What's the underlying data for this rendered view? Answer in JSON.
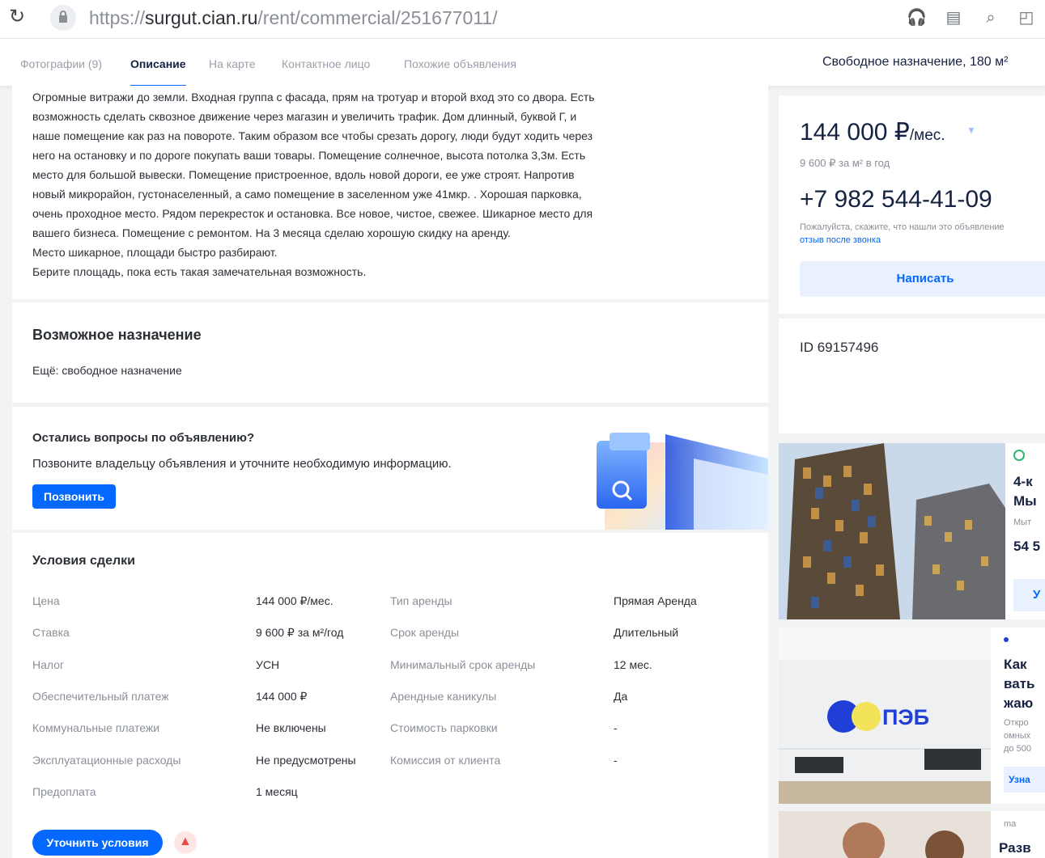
{
  "browser": {
    "url_scheme": "https://",
    "url_host": "surgut.cian.ru",
    "url_path": "/rent/commercial/251677011/"
  },
  "tabs": {
    "photos": "Фотографии (9)",
    "description": "Описание",
    "map": "На карте",
    "contact": "Контактное лицо",
    "similar": "Похожие объявления",
    "listing_title": "Свободное назначение, 180 м²"
  },
  "description": {
    "lines": [
      "Огромные витражи до земли. Входная группа с фасада, прям на тротуар и второй вход это со двора. Есть",
      "возможность сделать сквозное движение через магазин и увеличить трафик. Дом длинный, буквой Г, и",
      "наше помещение как раз на повороте. Таким образом все чтобы срезать дорогу, люди будут ходить через",
      "него на остановку и по дороге покупать ваши товары. Помещение солнечное, высота потолка 3,3м. Есть",
      "место для большой вывески. Помещение пристроенное, вдоль новой дороги, ее уже строят. Напротив",
      "новый микрорайон, густонаселенный, а само помещение в заселенном уже 41мкр. . Хорошая парковка,",
      "очень проходное место. Рядом перекресток и остановка. Все новое, чистое, свежее. Шикарное место для",
      "вашего бизнеса. Помещение с ремонтом. На 3 месяца сделаю хорошую скидку на аренду.",
      " Место шикарное, площади быстро разбирают.",
      "Берите площадь, пока есть такая замечательная возможность."
    ]
  },
  "purpose": {
    "title": "Возможное назначение",
    "text": "Ещё: свободное назначение"
  },
  "questions": {
    "title": "Остались вопросы по объявлению?",
    "text": "Позвоните владельцу объявления и уточните необходимую информацию.",
    "call_button": "Позвонить"
  },
  "terms": {
    "title": "Условия сделки",
    "left": [
      {
        "label": "Цена",
        "value": "144 000 ₽/мес."
      },
      {
        "label": "Ставка",
        "value": "9 600 ₽ за м²/год"
      },
      {
        "label": "Налог",
        "value": "УСН"
      },
      {
        "label": "Обеспечительный платеж",
        "value": "144 000 ₽"
      },
      {
        "label": "Коммунальные платежи",
        "value": "Не включены"
      },
      {
        "label": "Эксплуатационные расходы",
        "value": "Не предусмотрены"
      },
      {
        "label": "Предоплата",
        "value": "1 месяц"
      }
    ],
    "right": [
      {
        "label": "Тип аренды",
        "value": "Прямая Аренда"
      },
      {
        "label": "Срок аренды",
        "value": "Длительный"
      },
      {
        "label": "Минимальный срок аренды",
        "value": "12 мес."
      },
      {
        "label": "Арендные каникулы",
        "value": "Да"
      },
      {
        "label": "Стоимость парковки",
        "value": "-"
      },
      {
        "label": "Комиссия от клиента",
        "value": "-"
      }
    ],
    "clarify_button": "Уточнить условия"
  },
  "sidebar": {
    "price": "144 000 ₽",
    "price_unit": "/мес.",
    "price_per_m2": "9 600 ₽ за м² в год",
    "phone": "+7 982 544-41-09",
    "hint": "Пожалуйста, скажите, что нашли это объявление",
    "hint_link": "отзыв после звонка",
    "write_button": "Написать",
    "id": "ID 69157496"
  },
  "ads": [
    {
      "line1": "4-к",
      "line2": "Мы",
      "line3": "Мыт",
      "line4": "54 5",
      "button": "У"
    },
    {
      "brand_logo": "ПЭБ",
      "line1": "Как",
      "line2": "вать",
      "line3": "жаю",
      "sub1": "Откро",
      "sub2": "омных",
      "sub3": "до 500",
      "button": "Узна"
    },
    {
      "line1": "Разв",
      "tag": "ma"
    }
  ],
  "colors": {
    "accent": "#0468ff",
    "text": "#152242",
    "muted": "#8a8f98"
  }
}
